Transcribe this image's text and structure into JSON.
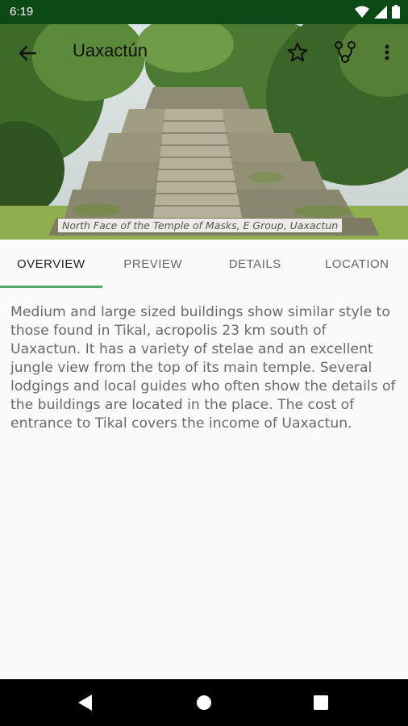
{
  "status_bar": {
    "time": "6:19"
  },
  "app_bar": {
    "title": "Uaxactún",
    "icons": [
      "back-arrow-icon",
      "star-outline-icon",
      "route-icon",
      "more-vert-icon"
    ]
  },
  "hero": {
    "caption": "North Face of the Temple of Masks, E Group, Uaxactun"
  },
  "tabs": [
    {
      "label": "OVERVIEW",
      "active": true
    },
    {
      "label": "PREVIEW",
      "active": false
    },
    {
      "label": "DETAILS",
      "active": false
    },
    {
      "label": "LOCATION",
      "active": false
    }
  ],
  "overview": {
    "text": "Medium and large sized buildings show similar style to those found in Tikal, acropolis 23 km south of Uaxactun. It has a variety of stelae and an excellent jungle view from the top of its main temple. Several lodgings and local guides who often show the details of the buildings are located in the place. The cost of entrance to Tikal covers the income of Uaxactun."
  },
  "colors": {
    "status_bar": "#0b4a16",
    "accent": "#5ca36a",
    "text": "#6a6a6a"
  },
  "nav_bar": {
    "icons": [
      "nav-back-icon",
      "nav-home-icon",
      "nav-recents-icon"
    ]
  }
}
